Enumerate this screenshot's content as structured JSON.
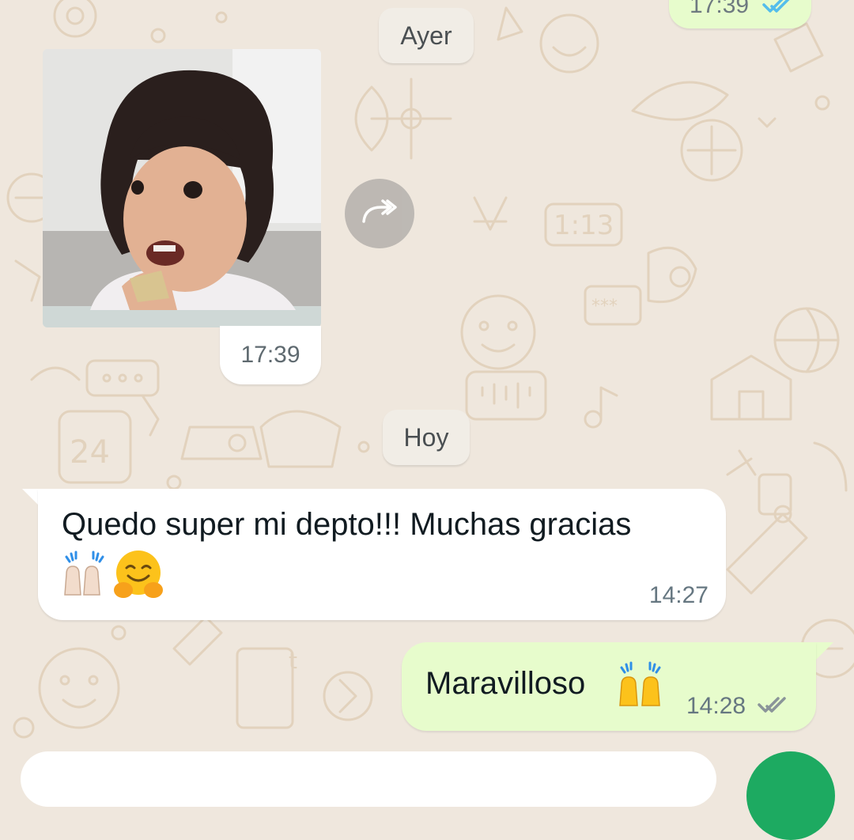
{
  "colors": {
    "wallpaper": "#efe7dd",
    "incoming_bubble": "#ffffff",
    "outgoing_bubble": "#e7fccc",
    "read_ticks": "#53bdeb",
    "sent_ticks": "#8a9499",
    "send_button": "#1daa61"
  },
  "top_message": {
    "time": "17:39",
    "status_icon": "double-check-read-icon"
  },
  "date_separators": {
    "ayer": "Ayer",
    "hoy": "Hoy"
  },
  "photo_message": {
    "time": "17:39",
    "forward_icon": "forward-icon"
  },
  "incoming_message": {
    "text": "Quedo super mi depto!!! Muchas gracias",
    "emojis": [
      "🙌🏻",
      "🤗"
    ],
    "time": "14:27"
  },
  "outgoing_message": {
    "text": "Maravilloso",
    "emoji": "🙌",
    "time": "14:28",
    "status_icon": "double-check-delivered-icon"
  }
}
